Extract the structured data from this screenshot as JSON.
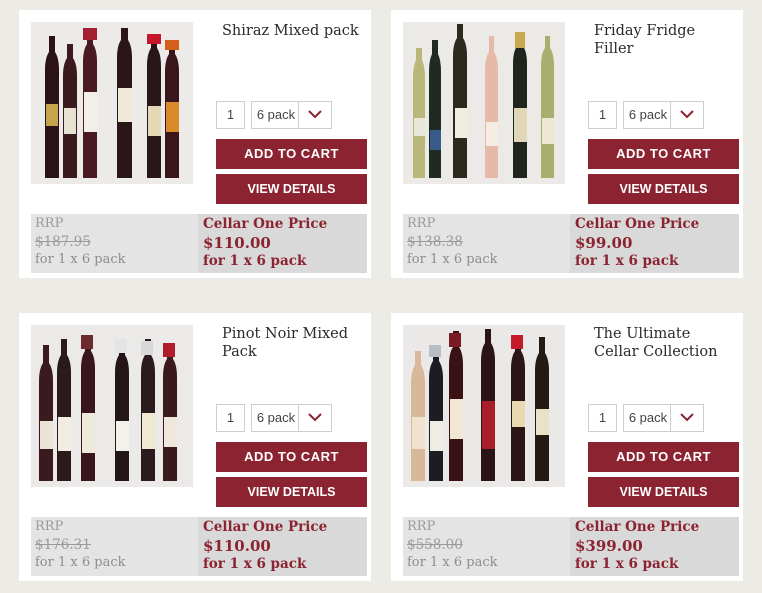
{
  "products": [
    {
      "title": "Shiraz Mixed pack",
      "quantity": "1",
      "pack": "6 pack",
      "add_to_cart": "ADD TO CART",
      "view_details": "VIEW DETAILS",
      "rrp_label": "RRP",
      "rrp_price": "$187.95",
      "rrp_for": "for 1 x 6 pack",
      "price_label": "Cellar One Price",
      "price": "$110.00",
      "price_for": "for 1 x 6 pack"
    },
    {
      "title": "Friday Fridge Filler",
      "quantity": "1",
      "pack": "6 pack",
      "add_to_cart": "ADD TO CART",
      "view_details": "VIEW DETAILS",
      "rrp_label": "RRP",
      "rrp_price": "$138.38",
      "rrp_for": "for 1 x 6 pack",
      "price_label": "Cellar One Price",
      "price": "$99.00",
      "price_for": "for 1 x 6 pack"
    },
    {
      "title": "Pinot Noir Mixed Pack",
      "quantity": "1",
      "pack": "6 pack",
      "add_to_cart": "ADD TO CART",
      "view_details": "VIEW DETAILS",
      "rrp_label": "RRP",
      "rrp_price": "$176.31",
      "rrp_for": "for 1 x 6 pack",
      "price_label": "Cellar One Price",
      "price": "$110.00",
      "price_for": "for 1 x 6 pack"
    },
    {
      "title": "The Ultimate Cellar Collection",
      "quantity": "1",
      "pack": "6 pack",
      "add_to_cart": "ADD TO CART",
      "view_details": "VIEW DETAILS",
      "rrp_label": "RRP",
      "rrp_price": "$558.00",
      "rrp_for": "for 1 x 6 pack",
      "price_label": "Cellar One Price",
      "price": "$399.00",
      "price_for": "for 1 x 6 pack"
    }
  ],
  "theme": {
    "accent": "#8b2331",
    "page_background": "#ecebe6",
    "card_background": "#ffffff"
  },
  "icons": {
    "dropdown": "chevron-down-icon"
  }
}
